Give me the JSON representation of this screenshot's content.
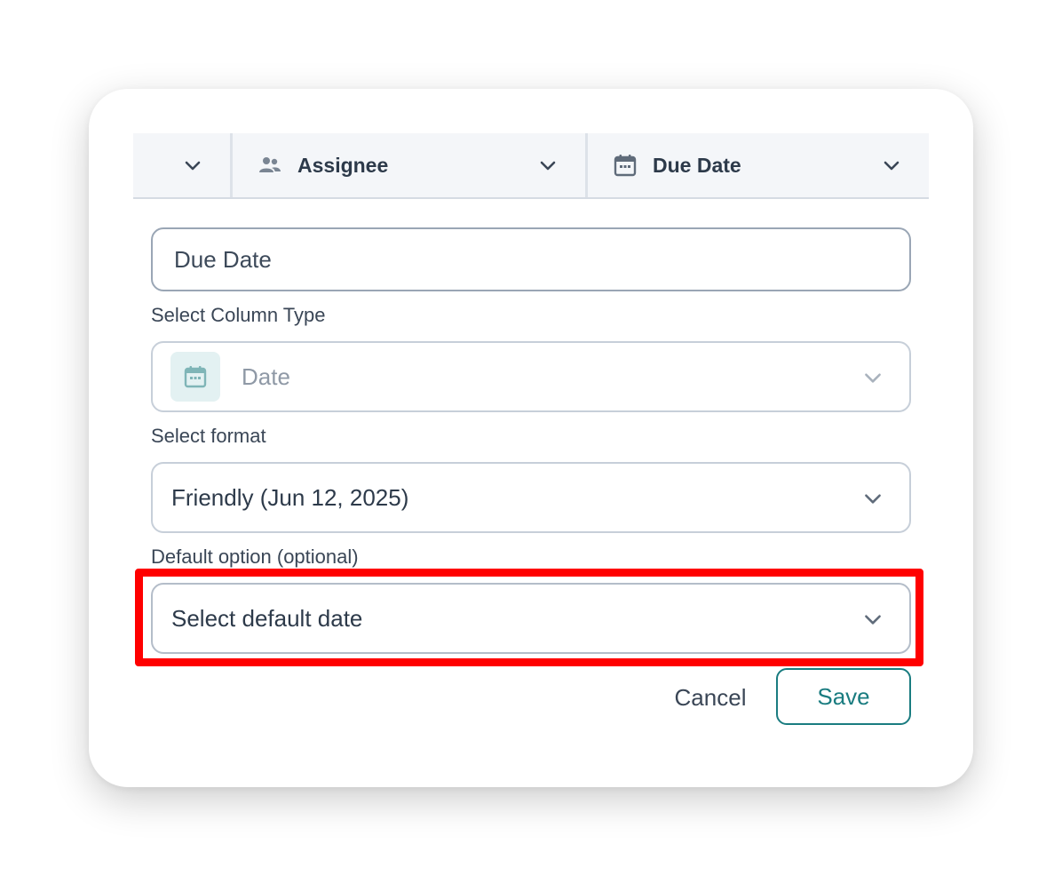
{
  "header": {
    "columns": [
      {
        "label": "",
        "icon": "chevron-down-icon"
      },
      {
        "label": "Assignee",
        "icon": "people-icon"
      },
      {
        "label": "Due Date",
        "icon": "calendar-icon"
      }
    ]
  },
  "form": {
    "name_value": "Due Date",
    "column_type_label": "Select Column Type",
    "column_type_value": "Date",
    "column_type_icon": "calendar-icon",
    "format_label": "Select format",
    "format_value": "Friendly (Jun 12, 2025)",
    "default_label": "Default option (optional)",
    "default_value": "Select default date"
  },
  "actions": {
    "cancel_label": "Cancel",
    "save_label": "Save"
  },
  "colors": {
    "accent": "#1a7c80",
    "highlight": "#ff0000",
    "header_bg": "#f4f6f9"
  }
}
